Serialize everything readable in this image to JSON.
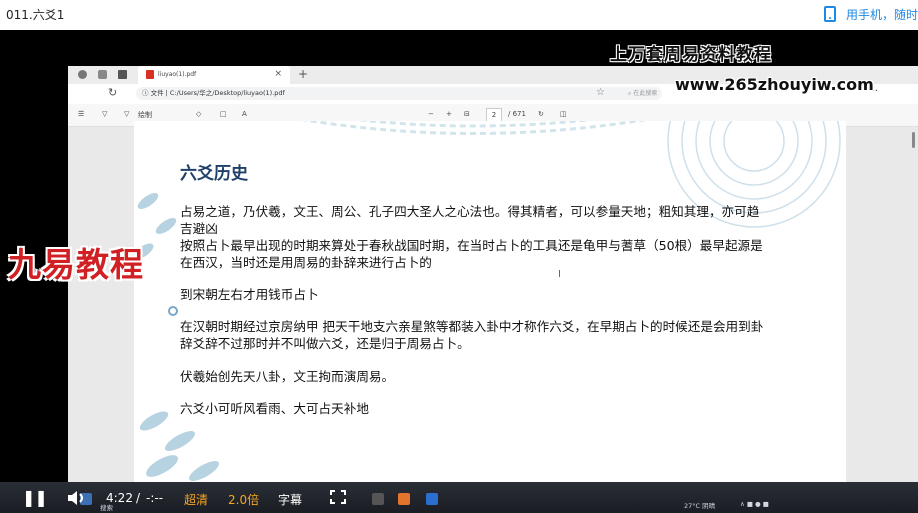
{
  "video": {
    "title": "011.六爻1",
    "mobile_text": "用手机，随时"
  },
  "browser": {
    "tab_title": "liuyao(1).pdf",
    "tab_close": "×",
    "new_tab": "+",
    "address_label": "文件",
    "address_path": "C:/Users/华之/Desktop/liuyao(1).pdf",
    "search_hint": "在此搜索",
    "more": "···"
  },
  "pdf_toolbar": {
    "draw": "绘制",
    "read_aloud": "A",
    "page_current": "2",
    "page_total": "/ 671"
  },
  "document": {
    "heading": "六爻历史",
    "lines": [
      "占易之道，乃伏羲，文王、周公、孔子四大圣人之心法也。得其精者，可以参量天地；粗知其理，亦可趋",
      "吉避凶",
      "按照占卜最早出现的时期来算处于春秋战国时期，在当时占卜的工具还是龟甲与蓍草（50根）最早起源是",
      "在西汉，当时还是用周易的卦辞来进行占卜的",
      "到宋朝左右才用钱币占卜",
      "在汉朝时期经过京房纳甲 把天干地支六亲星煞等都装入卦中才称作六爻，在早期占卜的时候还是会用到卦",
      "辞爻辞不过那时并不叫做六爻，还是归于周易占卜。",
      "伏羲始创先天八卦，文王拘而演周易。",
      "六爻小可听风看雨、大可占天补地"
    ]
  },
  "watermarks": {
    "top_text": "上万套周易资料教程",
    "site": "www.265zhouyiw.com",
    "logo": "九易教程"
  },
  "player": {
    "play_icon": "pause-icon",
    "time_current": "4:22",
    "time_sep": "/",
    "time_total": "-:--",
    "quality": "超清",
    "speed": "2.0倍",
    "subtitle": "字幕"
  },
  "taskbar": {
    "weather": "27°C 阴晴",
    "search": "搜索"
  },
  "colors": {
    "accent_blue": "#1e88e5",
    "heading": "#20406a",
    "logo_red": "#d02024",
    "player_orange": "#f5a623"
  }
}
